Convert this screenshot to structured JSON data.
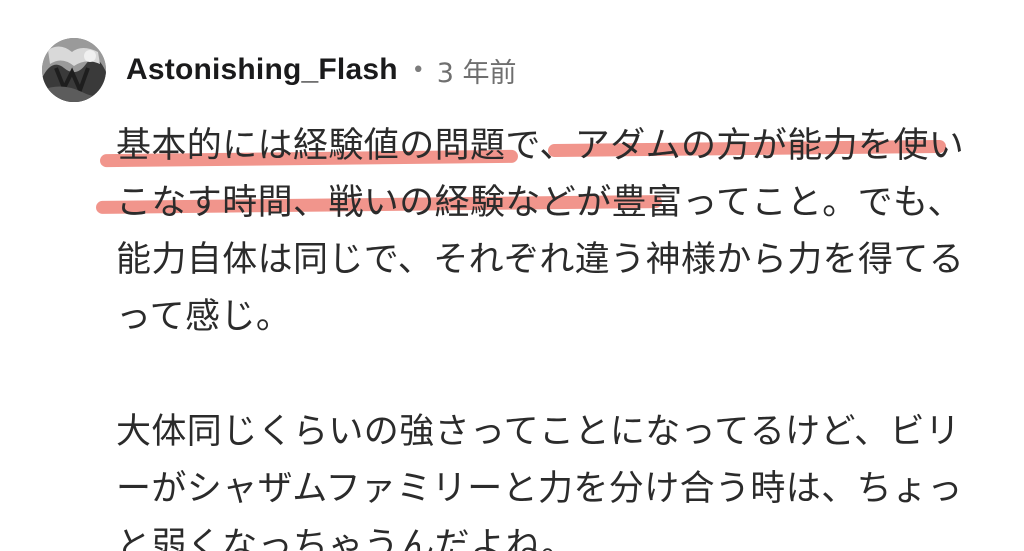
{
  "comment": {
    "author": "Astonishing_Flash",
    "separator": "•",
    "time_ago": "3 年前",
    "avatar_icon": "grayscale-avatar-photo",
    "highlight_color": "#f08a80",
    "paragraphs": [
      [
        "基本的には経験値の問題で、アダムの方が能力を使い",
        "こなす時間、戦いの経験などが豊富ってこと。でも、",
        "能力自体は同じで、それぞれ違う神様から力を得てる",
        "って感じ。"
      ],
      [
        "大体同じくらいの強さってことになってるけど、ビリ",
        "ーがシャザムファミリーと力を分け合う時は、ちょっ",
        "と弱くなっちゃうんだよね。"
      ]
    ]
  }
}
